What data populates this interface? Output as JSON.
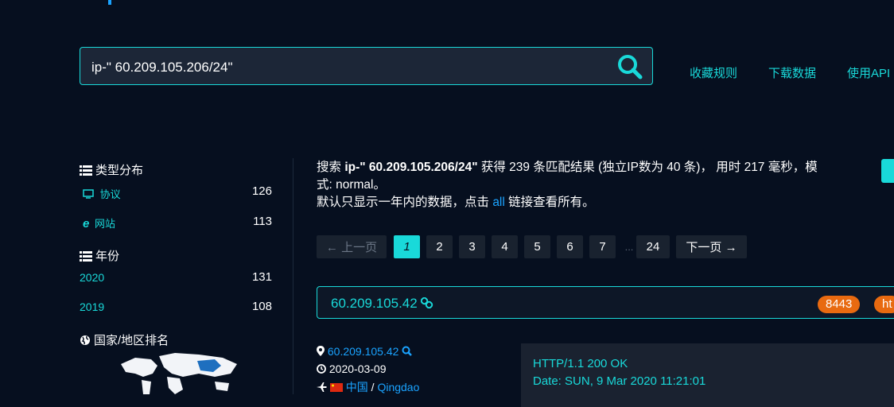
{
  "search": {
    "query": "ip-\" 60.209.105.206/24\""
  },
  "top_links": [
    "收藏规则",
    "下载数据",
    "使用API"
  ],
  "sidebar": {
    "type_heading": "类型分布",
    "types": [
      {
        "label": "协议",
        "count": "126",
        "icon": "monitor-icon"
      },
      {
        "label": "网站",
        "count": "113",
        "icon": "ie-icon"
      }
    ],
    "year_heading": "年份",
    "years": [
      {
        "label": "2020",
        "count": "131"
      },
      {
        "label": "2019",
        "count": "108"
      }
    ],
    "country_heading": "国家/地区排名"
  },
  "summary": {
    "prefix": "搜索 ",
    "query": "ip-\" 60.209.105.206/24\"",
    "middle": " 获得 239 条匹配结果 (独立IP数为 40 条)， 用时 217 毫秒，模式: normal。",
    "line2_a": "默认只显示一年内的数据，点击 ",
    "line2_link": "all",
    "line2_b": " 链接查看所有。"
  },
  "pagination": {
    "prev": "← 上一页",
    "pages": [
      "1",
      "2",
      "3",
      "4",
      "5",
      "6",
      "7"
    ],
    "dots": "...",
    "last": "24",
    "next": "下一页 →",
    "current": "1"
  },
  "result": {
    "ip": "60.209.105.42",
    "ports": [
      "8443",
      "ht"
    ],
    "meta_ip": "60.209.105.42",
    "date": "2020-03-09",
    "country": "中国",
    "city": "Qingdao",
    "response": [
      "HTTP/1.1 200 OK",
      "Date: SUN, 9 Mar 2020 11:21:01"
    ]
  },
  "colors": {
    "accent": "#19d9d9",
    "link": "#1aa3ff",
    "badge": "#e86a10",
    "background": "#060f1f"
  }
}
